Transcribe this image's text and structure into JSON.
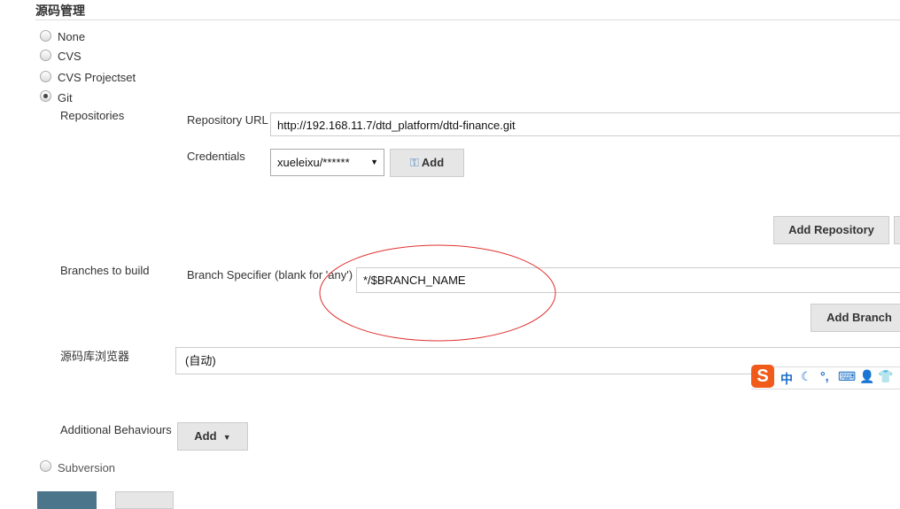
{
  "section_title": "源码管理",
  "scm_options": [
    {
      "label": "None",
      "selected": false
    },
    {
      "label": "CVS",
      "selected": false
    },
    {
      "label": "CVS Projectset",
      "selected": false
    },
    {
      "label": "Git",
      "selected": true
    },
    {
      "label": "Subversion",
      "selected": false
    }
  ],
  "git": {
    "repositories_label": "Repositories",
    "repo_url_label": "Repository URL",
    "repo_url_value": "http://192.168.11.7/dtd_platform/dtd-finance.git",
    "credentials_label": "Credentials",
    "credentials_value": "xueleixu/******",
    "add_credentials_label": "Add",
    "add_repository_label": "Add Repository",
    "branches_label": "Branches to build",
    "branch_specifier_label": "Branch Specifier (blank for 'any')",
    "branch_specifier_value": "*/$BRANCH_NAME",
    "add_branch_label": "Add Branch",
    "repo_browser_label": "源码库浏览器",
    "repo_browser_value": "(自动)",
    "additional_behaviours_label": "Additional Behaviours",
    "add_behaviour_label": "Add"
  },
  "ime_toolbar": {
    "logo": "S",
    "mode": "中",
    "punct": "°,"
  },
  "colors": {
    "annotation": "#e03030",
    "primary_button": "#4b758b"
  }
}
